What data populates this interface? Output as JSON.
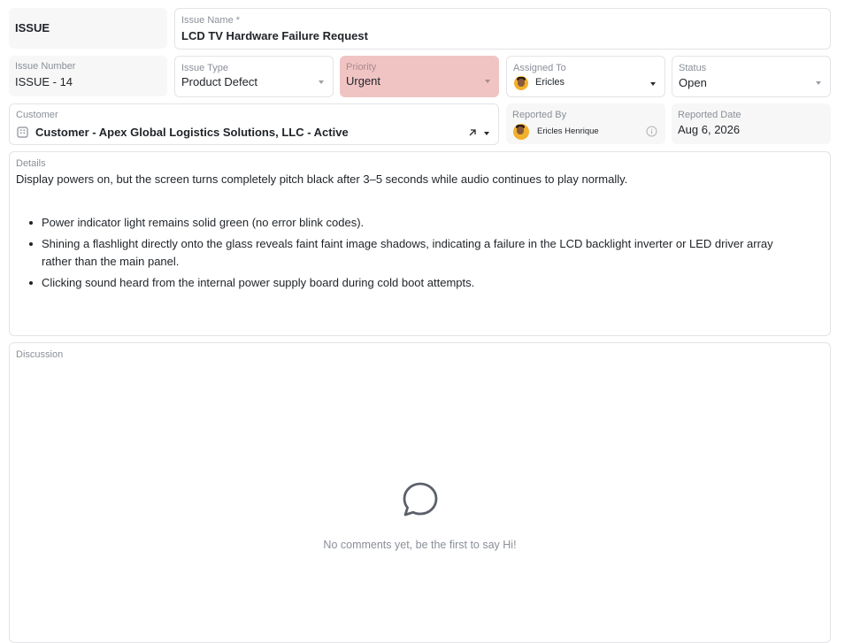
{
  "record_type": "ISSUE",
  "issue_name": {
    "label": "Issue Name *",
    "value": "LCD TV Hardware Failure Request"
  },
  "issue_number": {
    "label": "Issue Number",
    "value": "ISSUE - 14"
  },
  "issue_type": {
    "label": "Issue Type",
    "value": "Product Defect"
  },
  "priority": {
    "label": "Priority",
    "value": "Urgent",
    "color": "#f1c4c4"
  },
  "assigned_to": {
    "label": "Assigned To",
    "value": "Ericles",
    "icon": "user-avatar"
  },
  "status": {
    "label": "Status",
    "value": "Open"
  },
  "customer": {
    "label": "Customer",
    "value": "Customer - Apex Global Logistics Solutions, LLC - Active",
    "icon": "building-icon"
  },
  "reported_by": {
    "label": "Reported By",
    "value": "Ericles Henrique",
    "icon": "info-icon"
  },
  "reported_date": {
    "label": "Reported Date",
    "value": "Aug 6, 2026"
  },
  "details": {
    "label": "Details",
    "text": "Display powers on, but the screen turns completely pitch black after 3–5 seconds while audio continues to play normally.",
    "bullets": [
      "Power indicator light remains solid green (no error blink codes).",
      "Shining a flashlight directly onto the glass reveals faint faint image shadows, indicating a failure in the LCD backlight inverter or LED driver array rather than the main panel.",
      "Clicking sound heard from the internal power supply board during cold boot attempts."
    ]
  },
  "discussion": {
    "label": "Discussion",
    "empty_text": "No comments yet, be the first to say Hi!",
    "icon": "chat-bubble-icon"
  }
}
